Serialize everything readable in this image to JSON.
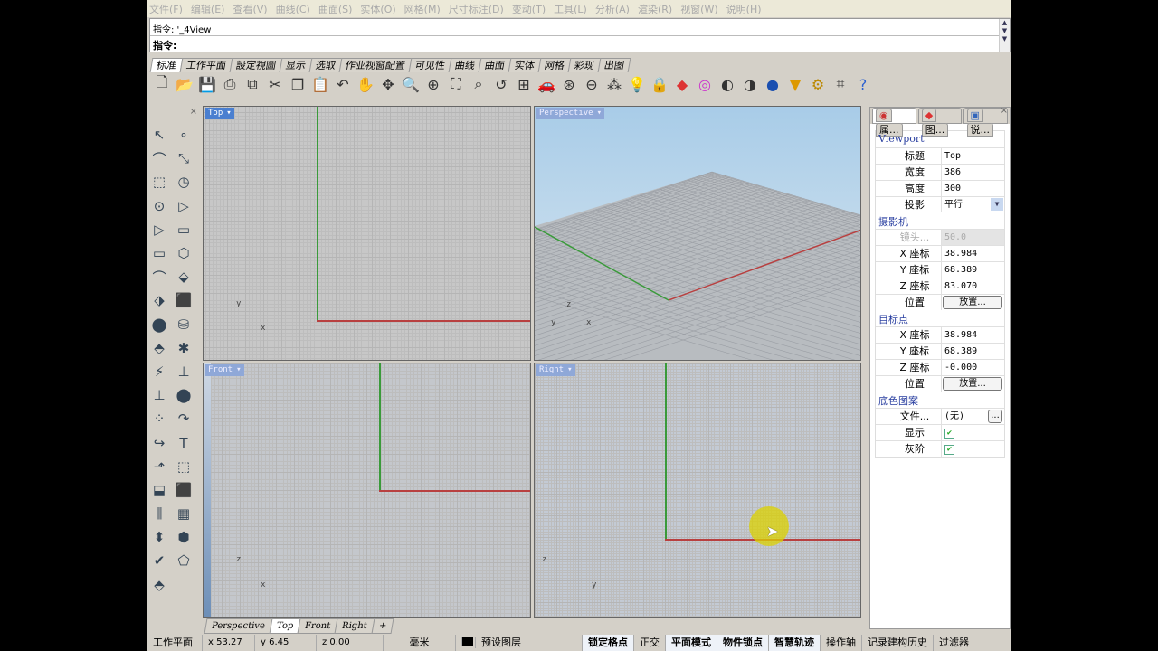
{
  "menu": [
    "文件(F)",
    "编辑(E)",
    "查看(V)",
    "曲线(C)",
    "曲面(S)",
    "实体(O)",
    "网格(M)",
    "尺寸标注(D)",
    "变动(T)",
    "工具(L)",
    "分析(A)",
    "渲染(R)",
    "视窗(W)",
    "说明(H)"
  ],
  "command": {
    "history": "指令: '_4View",
    "prompt": "指令:"
  },
  "tabs": [
    "标准",
    "工作平面",
    "設定視圖",
    "显示",
    "选取",
    "作业视窗配置",
    "可见性",
    "曲线",
    "曲面",
    "实体",
    "网格",
    "彩现",
    "出图"
  ],
  "toolbar_icons": [
    "new-icon",
    "open-icon",
    "save-icon",
    "print-icon",
    "import-icon",
    "cut-icon",
    "copy-icon",
    "paste-icon",
    "undo-icon",
    "pan-hand-icon",
    "rotate-icon",
    "zoom-icon",
    "zoom-window-icon",
    "zoom-extents-icon",
    "zoom-selected-icon",
    "undo-view-icon",
    "four-view-icon",
    "car-icon",
    "mesh-icon",
    "cplane-icon",
    "points-icon",
    "light-icon",
    "lock-icon",
    "layer-icon",
    "color-wheel-icon",
    "shaded-sphere-icon",
    "render-sphere-icon",
    "blue-sphere-icon",
    "select-filter-icon",
    "gear-icon",
    "snap-icon",
    "help-icon"
  ],
  "viewports": {
    "top": {
      "label": "Top",
      "x": "x",
      "y": "y"
    },
    "perspective": {
      "label": "Perspective",
      "x": "x",
      "y": "y",
      "z": "z"
    },
    "front": {
      "label": "Front",
      "x": "x",
      "z": "z"
    },
    "right": {
      "label": "Right",
      "y": "y",
      "z": "z"
    }
  },
  "viewport_tabs": [
    "Perspective",
    "Top",
    "Front",
    "Right",
    "+"
  ],
  "status": {
    "cplane": "工作平面",
    "x": "x 53.27",
    "y": "y 6.45",
    "z": "z 0.00",
    "units": "毫米",
    "layer": "预设图层",
    "toggles": [
      {
        "label": "锁定格点",
        "on": true
      },
      {
        "label": "正交",
        "on": false
      },
      {
        "label": "平面模式",
        "on": true
      },
      {
        "label": "物件锁点",
        "on": true
      },
      {
        "label": "智慧轨迹",
        "on": true
      },
      {
        "label": "操作轴",
        "on": false
      },
      {
        "label": "记录建构历史",
        "on": false
      },
      {
        "label": "过滤器",
        "on": false
      }
    ]
  },
  "panel": {
    "tabs": [
      "属...",
      "图...",
      "说..."
    ],
    "viewport": {
      "section": "Viewport",
      "title_k": "标题",
      "title_v": "Top",
      "width_k": "宽度",
      "width_v": "386",
      "height_k": "高度",
      "height_v": "300",
      "proj_k": "投影",
      "proj_v": "平行"
    },
    "camera": {
      "section": "摄影机",
      "lens_k": "镜头...",
      "lens_v": "50.0",
      "x_k": "X 座标",
      "x_v": "38.984",
      "y_k": "Y 座标",
      "y_v": "68.389",
      "z_k": "Z 座标",
      "z_v": "83.070",
      "pos_k": "位置",
      "pos_btn": "放置..."
    },
    "target": {
      "section": "目标点",
      "x_k": "X 座标",
      "x_v": "38.984",
      "y_k": "Y 座标",
      "y_v": "68.389",
      "z_k": "Z 座标",
      "z_v": "-0.000",
      "pos_k": "位置",
      "pos_btn": "放置..."
    },
    "wallpaper": {
      "section": "底色图案",
      "file_k": "文件...",
      "file_v": "(无)",
      "file_btn": "...",
      "show_k": "显示",
      "show_checked": true,
      "gray_k": "灰阶",
      "gray_checked": true
    }
  }
}
